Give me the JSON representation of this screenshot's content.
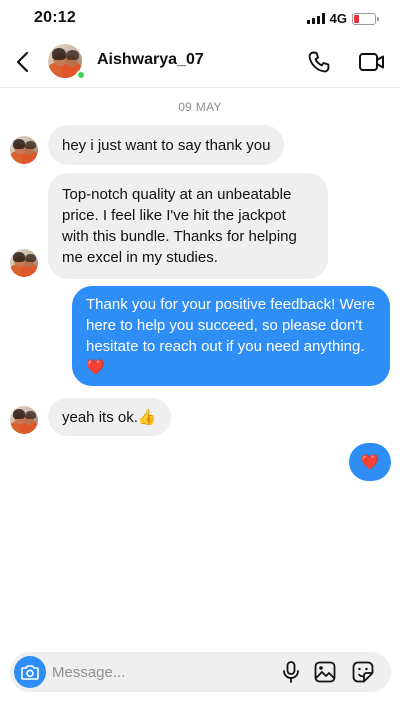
{
  "status": {
    "time": "20:12",
    "network": "4G",
    "battery_level_fraction": 0.25,
    "battery_color": "#e8333a"
  },
  "header": {
    "back_icon": "chevron-left-icon",
    "username": "Aishwarya_07",
    "online": true,
    "call_icon": "phone-icon",
    "video_icon": "video-camera-icon"
  },
  "chat": {
    "date": "09 MAY",
    "messages": [
      {
        "from": "them",
        "text": "hey i just want to say thank you"
      },
      {
        "from": "them",
        "text": "Top-notch quality at an unbeatable price. I feel like I've hit the jackpot with this bundle. Thanks for helping me excel in my studies."
      },
      {
        "from": "me",
        "text": "Thank you for your positive feedback! Were here to help you succeed, so please don't hesitate to reach out if you need anything. ❤️"
      },
      {
        "from": "them",
        "text": "yeah its ok.👍"
      },
      {
        "from": "me",
        "text": "❤️"
      }
    ]
  },
  "composer": {
    "placeholder": "Message...",
    "camera_icon": "camera-icon",
    "mic_icon": "microphone-icon",
    "gallery_icon": "image-icon",
    "sticker_icon": "sticker-icon"
  },
  "colors": {
    "outgoing_bubble": "#2e8ef5",
    "incoming_bubble": "#efefef",
    "online_dot": "#3ecf57"
  }
}
